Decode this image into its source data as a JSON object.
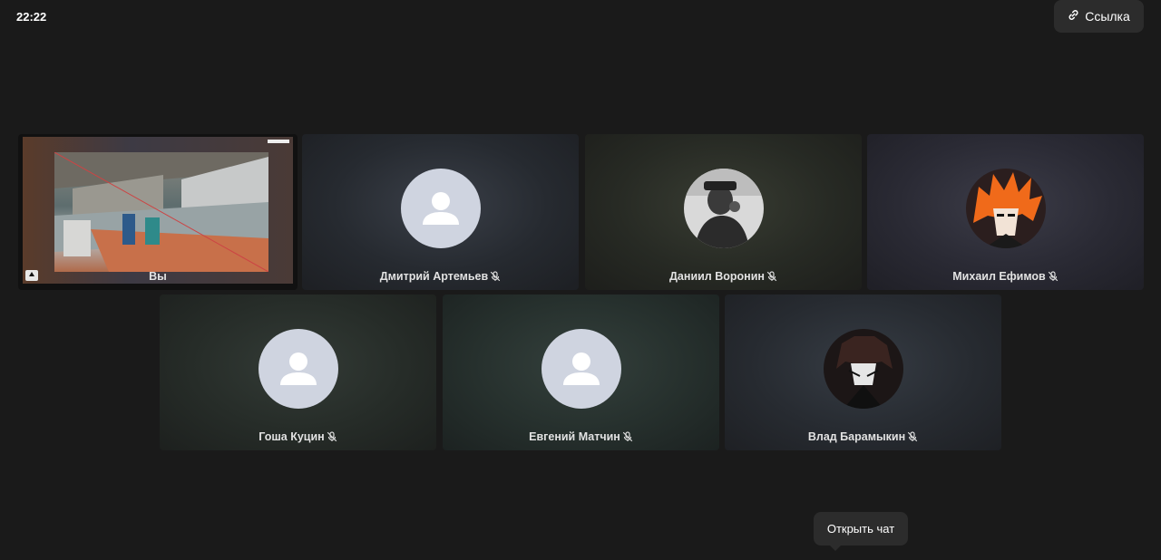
{
  "clock": "22:22",
  "header": {
    "link_label": "Ссылка"
  },
  "self": {
    "name": "Вы"
  },
  "participants": [
    {
      "name": "Дмитрий Артемьев",
      "avatar": "placeholder-person-icon",
      "muted": true
    },
    {
      "name": "Даниил Воронин",
      "avatar": "photo-avatar",
      "muted": true
    },
    {
      "name": "Михаил Ефимов",
      "avatar": "anime-avatar",
      "muted": true
    },
    {
      "name": "Гоша Куцин",
      "avatar": "placeholder-person-icon",
      "muted": true
    },
    {
      "name": "Евгений Матчин",
      "avatar": "placeholder-person-icon",
      "muted": true
    },
    {
      "name": "Влад Барамыкин",
      "avatar": "anime-avatar",
      "muted": true
    }
  ],
  "tooltip": {
    "label": "Открыть чат"
  },
  "colors": {
    "background": "#1a1a1a",
    "button": "#2c2c2c",
    "placeholder": "#cfd4e0"
  }
}
